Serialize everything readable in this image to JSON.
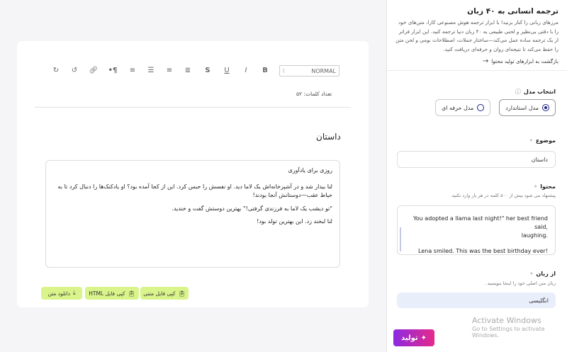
{
  "sidebar": {
    "title": "ترجمه انسانی به ۴۰ زبان",
    "description": "مرزهای زبانی را کنار بزنید! با ابزار ترجمه هوش مصنوعی کارا، متن‌های خود را با دقتی بی‌نظیر و لحنی طبیعی به ۴۰ زبان دنیا ترجمه کنید. این ابزار فراتر از یک ترجمه ساده عمل می‌کند—ساختار جملات، اصطلاحات بومی و لحن متن را حفظ می‌کند تا نتیجه‌ای روان و حرفه‌ای دریافت کنید.",
    "back_link": "بازگشت به ابزارهای تولید محتوا",
    "model": {
      "label": "انتخاب مدل",
      "options": [
        {
          "label": "مدل استاندارد",
          "selected": true
        },
        {
          "label": "مدل حرفه ای",
          "selected": false
        }
      ]
    },
    "topic": {
      "label": "موضوع",
      "value": "داستان"
    },
    "content": {
      "label": "محتوا",
      "hint": "پیشنهاد می شود بیش از ۵۰۰ کلمه در هر بار وارد نکنید.",
      "line1": "You adopted a llama last night!\" her best friend said,",
      "line2": "laughing.",
      "line3": "Lena smiled. This was the best birthday ever!"
    },
    "from_language": {
      "label": "از زبان",
      "hint": "زبان متن اصلی خود را اینجا بنویسید .",
      "value": "انگلیسی"
    },
    "generate_label": "تولید"
  },
  "watermark": {
    "line1": "Activate Windows",
    "line2": "Go to Settings to activate Windows."
  },
  "editor": {
    "format_select": "NORMAL",
    "word_count": "تعداد کلمات: ۵۲",
    "doc_title": "داستان",
    "paragraphs": [
      "روزی برای یادآوری",
      "لنا بیدار شد و در آشپزخانه‌اش یک لاما دید. او نفسش را حبس کرد. این از کجا آمده بود؟ او یادکنک‌ها را دنبال کرد تا به حیاط عقب—دوستانش آنجا بودند!",
      "\"تو دیشب یک لاما به فرزندی گرفتی!\" بهترین دوستش گفت و خندید.",
      "لنا لبخند زد. این بهترین تولد بود!"
    ],
    "actions": {
      "copy_text": "کپی فایل متنی",
      "copy_html": "کپی فایل HTML",
      "download": "دانلود متن"
    }
  },
  "colors": {
    "accent_start": "#8b2be2",
    "accent_end": "#e6298a",
    "action_bg": "#d8f48a",
    "language_bg": "#e9eefb"
  }
}
